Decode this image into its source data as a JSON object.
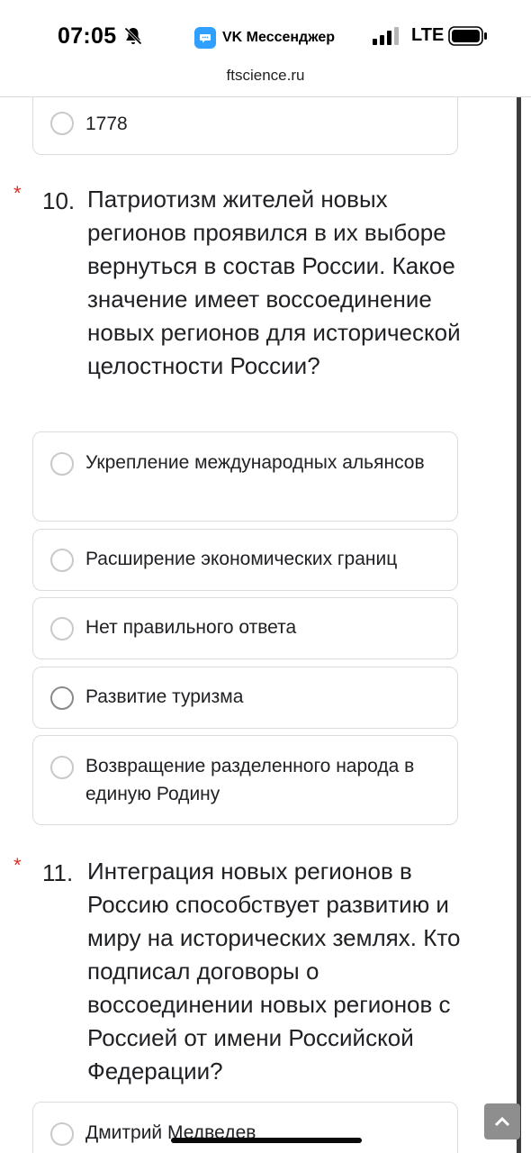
{
  "status_bar": {
    "time": "07:05",
    "app_name": "VK Мессенджер",
    "network": "LTE"
  },
  "browser": {
    "url": "ftscience.ru"
  },
  "previous_option": {
    "label": "1778"
  },
  "questions": [
    {
      "number": "10.",
      "required_mark": "*",
      "text": "Патриотизм жителей новых регионов проявился в их выборе вернуться в состав России. Какое значение имеет воссоединение новых регионов для исторической целостности России?",
      "options": [
        "Укрепление международных альянсов",
        "Расширение экономических границ",
        "Нет правильного ответа",
        "Развитие туризма",
        "Возвращение разделенного народа в единую Родину"
      ]
    },
    {
      "number": "11.",
      "required_mark": "*",
      "text": "Интеграция новых регионов в Россию способствует развитию и миру на исторических землях. Кто подписал договоры о воссоединении новых регионов с Россией от имени Российской Федерации?",
      "options": [
        "Дмитрий Медведев"
      ]
    }
  ],
  "icons": {
    "bell": "bell-slash-icon",
    "app": "vk-messenger-icon",
    "signal": "signal-bars-icon",
    "battery": "battery-icon",
    "scroll_top": "chevron-up-icon"
  },
  "colors": {
    "required": "#d93025",
    "vk_blue": "#2fa0ff",
    "card_border": "#dadce0"
  }
}
